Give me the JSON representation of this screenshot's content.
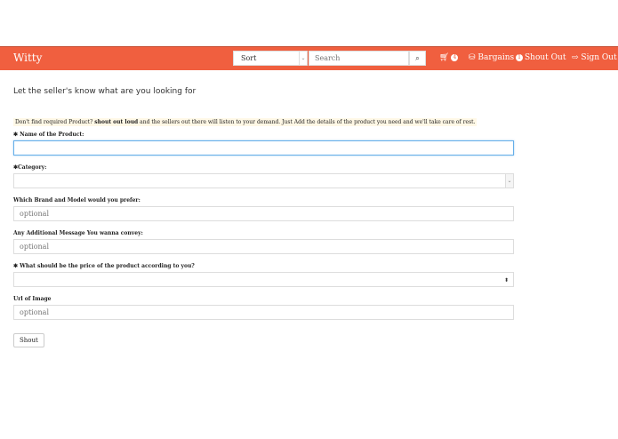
{
  "navbar": {
    "brand": "Witty",
    "sort": {
      "value": "Sort",
      "caret": "⌄"
    },
    "search": {
      "placeholder": "Search",
      "icon": "search-icon",
      "glyph": "🔍"
    },
    "cart": {
      "icon": "cart-icon",
      "glyph": "🛒",
      "count": "4"
    },
    "bargains": {
      "icon": "basket-icon",
      "glyph": "🧺",
      "label": "Bargains",
      "count": "1"
    },
    "shout_out": "Shout Out",
    "sign_out": {
      "icon": "sign-out-icon",
      "glyph": "⇨",
      "label": "Sign Out"
    },
    "accent": "#f05f3f"
  },
  "form": {
    "heading": "Let the seller's know what are you looking for",
    "notice_prefix": "Don't find required Product?",
    "notice_bold": "shout out loud",
    "notice_suffix": "and the sellers out there will listen to your demand. Just Add the details of the product you need and we'll take care of rest.",
    "fields": {
      "name": {
        "label": "✱ Name of the Product:",
        "value": ""
      },
      "category": {
        "label": "✱Category:",
        "value": ""
      },
      "brand": {
        "label": "Which Brand and Model would you prefer:",
        "placeholder": "optional"
      },
      "message": {
        "label": "Any Additional Message You wanna convey:",
        "placeholder": "optional"
      },
      "price": {
        "label": "✱ What should be the price of the product according to you?",
        "value": "",
        "spinner": "⬍"
      },
      "image_url": {
        "label": "Url of Image",
        "placeholder": "optional"
      }
    },
    "submit_label": "Shout"
  }
}
